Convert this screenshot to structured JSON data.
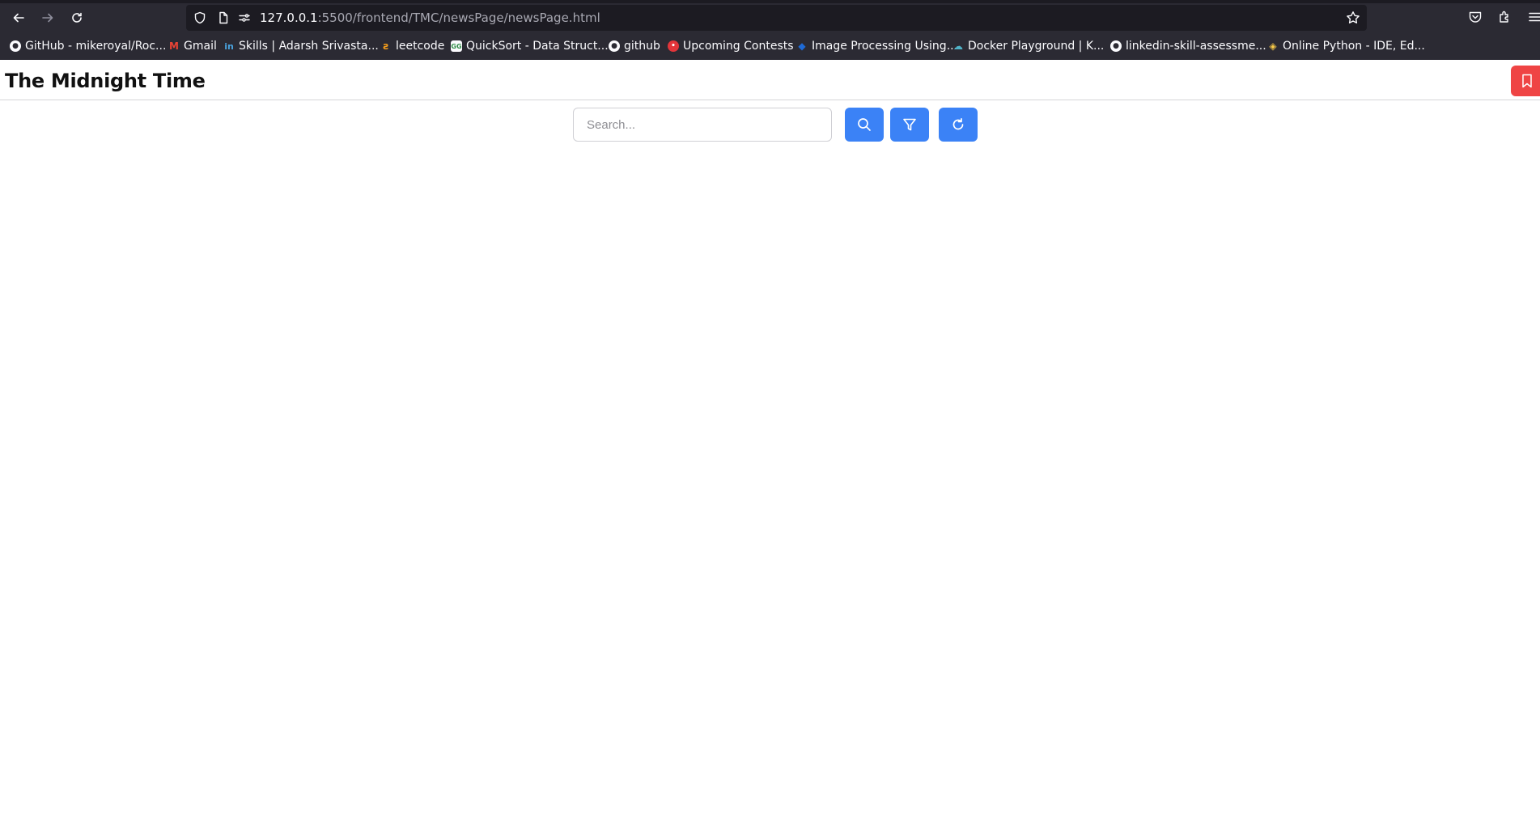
{
  "browser": {
    "url_host": "127.0.0.1",
    "url_path": ":5500/frontend/TMC/newsPage/newsPage.html",
    "bookmarks": [
      {
        "label": "GitHub - mikeroyal/Roc...",
        "icon": "github-icon"
      },
      {
        "label": "Gmail",
        "icon": "gmail-icon"
      },
      {
        "label": "Skills | Adarsh Srivasta...",
        "icon": "linkedin-icon"
      },
      {
        "label": "leetcode",
        "icon": "leetcode-icon"
      },
      {
        "label": "QuickSort - Data Struct...",
        "icon": "geeksforgeeks-icon"
      },
      {
        "label": "github",
        "icon": "github-icon"
      },
      {
        "label": "Upcoming Contests",
        "icon": "codechef-icon"
      },
      {
        "label": "Image Processing Using...",
        "icon": "drop-icon"
      },
      {
        "label": "Docker Playground | K...",
        "icon": "cloud-icon"
      },
      {
        "label": "linkedin-skill-assessme...",
        "icon": "github-icon"
      },
      {
        "label": "Online Python - IDE, Ed...",
        "icon": "python-icon"
      }
    ]
  },
  "header": {
    "title": "The Midnight Time"
  },
  "search": {
    "placeholder": "Search...",
    "value": ""
  },
  "colors": {
    "accent": "#3b82f6",
    "danger": "#ef4444",
    "chrome_bg": "#2b2a33"
  }
}
